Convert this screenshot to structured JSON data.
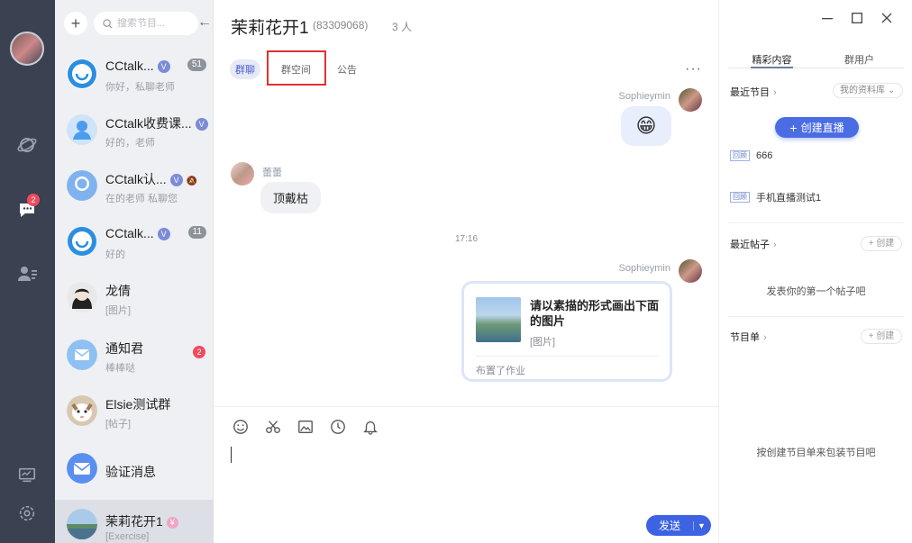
{
  "conv_search": {
    "placeholder": "搜索节目..."
  },
  "conversations": [
    {
      "name": "CCtalk...",
      "sub": "你好，私聊老师",
      "count": "51"
    },
    {
      "name": "CCtalk收费课...",
      "sub": "好的，老师"
    },
    {
      "name": "CCtalk认...",
      "sub": "在的老师 私聊您"
    },
    {
      "name": "CCtalk...",
      "sub": "好的",
      "count": "11"
    },
    {
      "name": "龙倩",
      "sub": "[图片]"
    },
    {
      "name": "通知君",
      "sub": "棒棒哒",
      "count": "2"
    },
    {
      "name": "Elsie测试群",
      "sub": "[帖子]"
    },
    {
      "name": "验证消息",
      "sub": ""
    },
    {
      "name": "茉莉花开1",
      "sub": "[Exercise]"
    }
  ],
  "rail": {
    "chat_badge": "2"
  },
  "chat": {
    "title": "茉莉花开1",
    "id": "(83309068)",
    "member_count": "3 人",
    "tabs": [
      "群聊",
      "群空间",
      "公告"
    ],
    "more": "···",
    "messages": [
      {
        "sender": "Sophieymin",
        "emoji": "😁"
      },
      {
        "sender": "蕾蕾",
        "text": "顶戴枯"
      }
    ],
    "timestamp": "17:16",
    "card": {
      "sender": "Sophieymin",
      "title": "请以素描的形式画出下面的图片",
      "sub": "[图片]",
      "footer": "布置了作业"
    },
    "send_label": "发送"
  },
  "right_panel": {
    "tabs": [
      "精彩内容",
      "群用户"
    ],
    "recent_programs": "最近节目",
    "library_dropdown": "我的资料库",
    "create_live": "创建直播",
    "replays": [
      {
        "tag": "回顾",
        "title": "666"
      },
      {
        "tag": "回顾",
        "title": "手机直播测试1"
      }
    ],
    "recent_posts": "最近帖子",
    "create": "+ 创建",
    "posts_empty": "发表你的第一个帖子吧",
    "program_list": "节目单",
    "program_empty": "按创建节目单来包装节目吧"
  },
  "colors": {
    "accent": "#3d63e3",
    "rail": "#3a4150",
    "badge": "#f04a5e",
    "highlight": "#e03030"
  }
}
